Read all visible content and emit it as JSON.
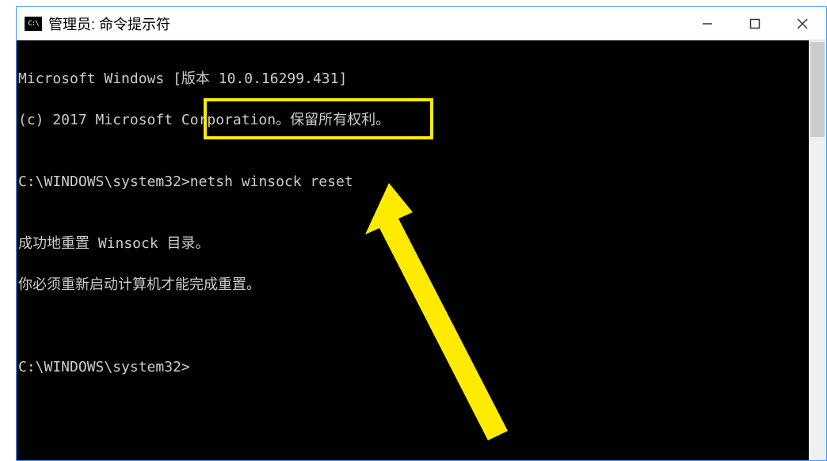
{
  "window": {
    "title": "管理员: 命令提示符",
    "icon_label": "C:\\"
  },
  "terminal": {
    "line1": "Microsoft Windows [版本 10.0.16299.431]",
    "line2": "(c) 2017 Microsoft Corporation。保留所有权利。",
    "blank1": "",
    "prompt1_path": "C:\\WINDOWS\\system32>",
    "prompt1_cmd": "netsh winsock reset",
    "blank2": "",
    "result1": "成功地重置 Winsock 目录。",
    "result2": "你必须重新启动计算机才能完成重置。",
    "blank3": "",
    "blank4": "",
    "prompt2": "C:\\WINDOWS\\system32>"
  },
  "annotation": {
    "highlighted_command": "netsh winsock reset"
  }
}
